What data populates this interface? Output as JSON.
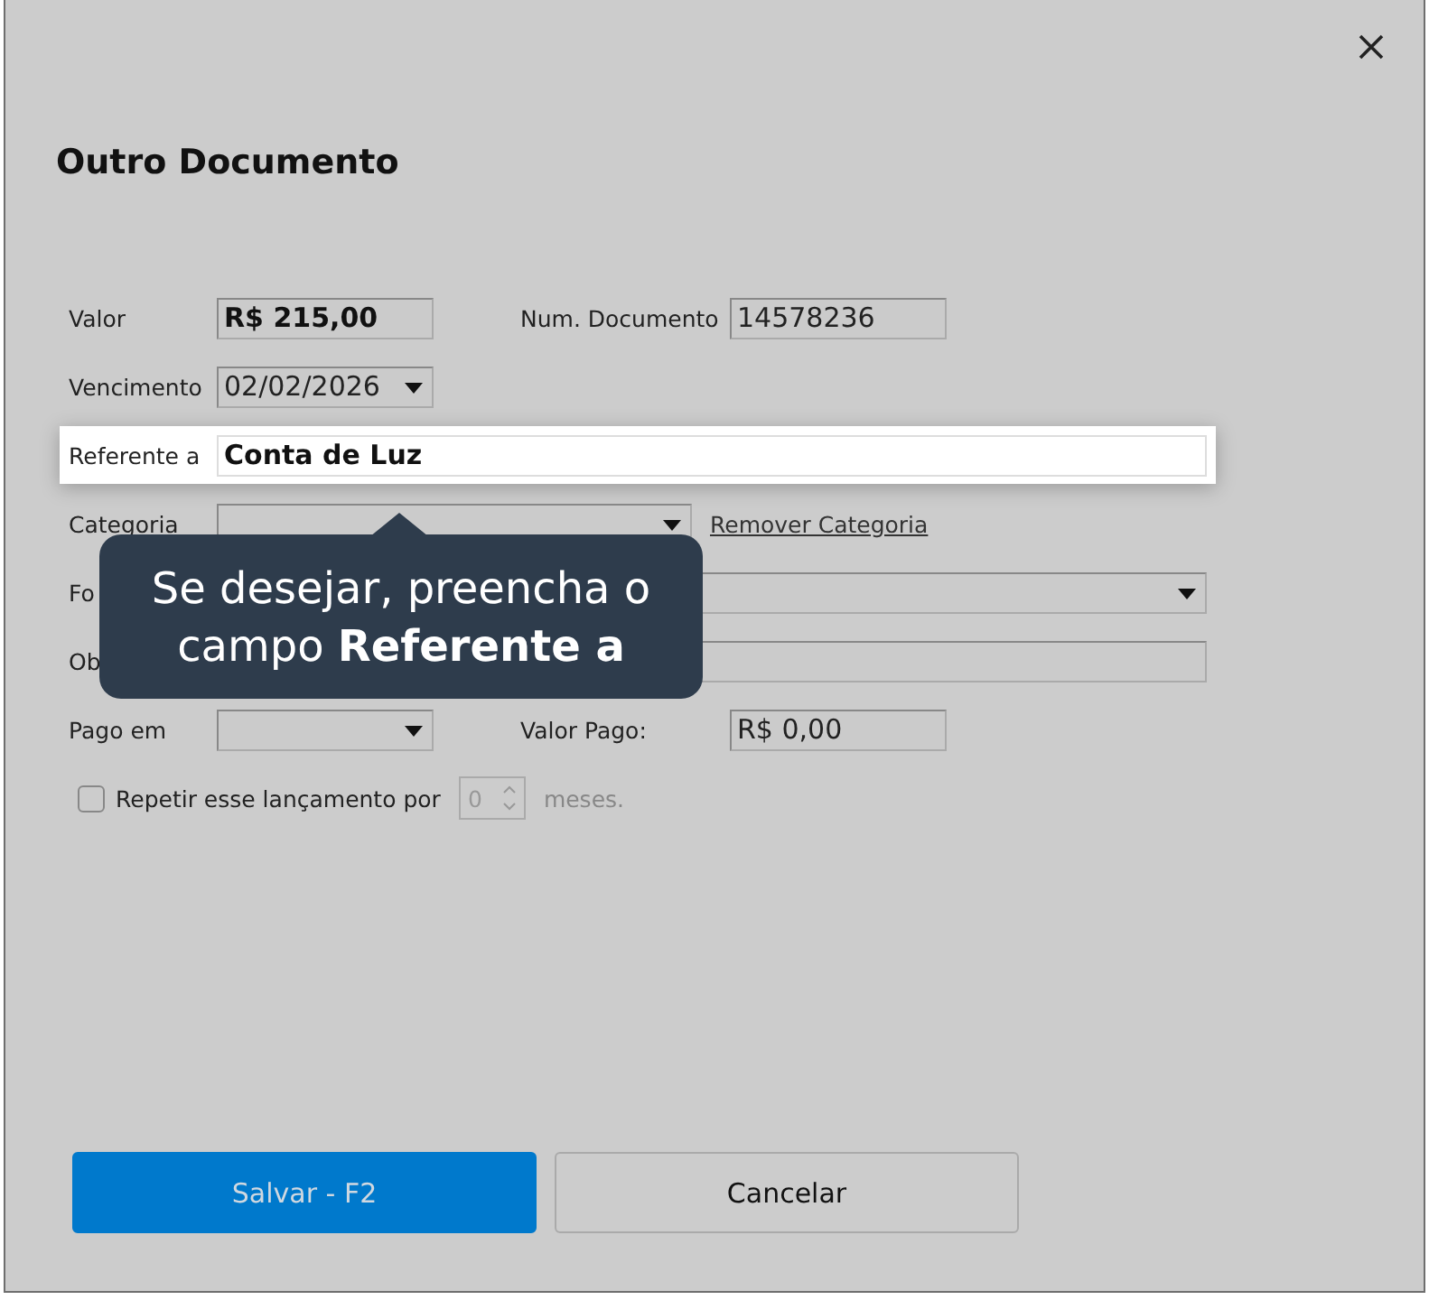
{
  "dialog": {
    "title": "Outro Documento"
  },
  "valor": {
    "label": "Valor",
    "value": "R$ 215,00"
  },
  "num_documento": {
    "label": "Num. Documento",
    "value": "14578236"
  },
  "vencimento": {
    "label": "Vencimento",
    "value": "02/02/2026"
  },
  "referente": {
    "label": "Referente a",
    "value": "Conta de Luz",
    "highlighted": true
  },
  "categoria": {
    "label": "Categoria",
    "link": "Remover Categoria"
  },
  "forma": {
    "label": "Fo"
  },
  "obs": {
    "label": "Ob"
  },
  "pago_em": {
    "label": "Pago em"
  },
  "valor_pago": {
    "label": "Valor Pago:",
    "value": "R$ 0,00"
  },
  "repeat": {
    "label": "Repetir esse lançamento por",
    "checked": false,
    "count": "0",
    "unit": "meses."
  },
  "tooltip": {
    "text": "Se desejar, preencha o campo **Referente a**"
  },
  "buttons": [
    {
      "label": "Salvar - F2",
      "kind": "primary"
    },
    {
      "label": "Cancelar",
      "kind": "secondary"
    }
  ]
}
